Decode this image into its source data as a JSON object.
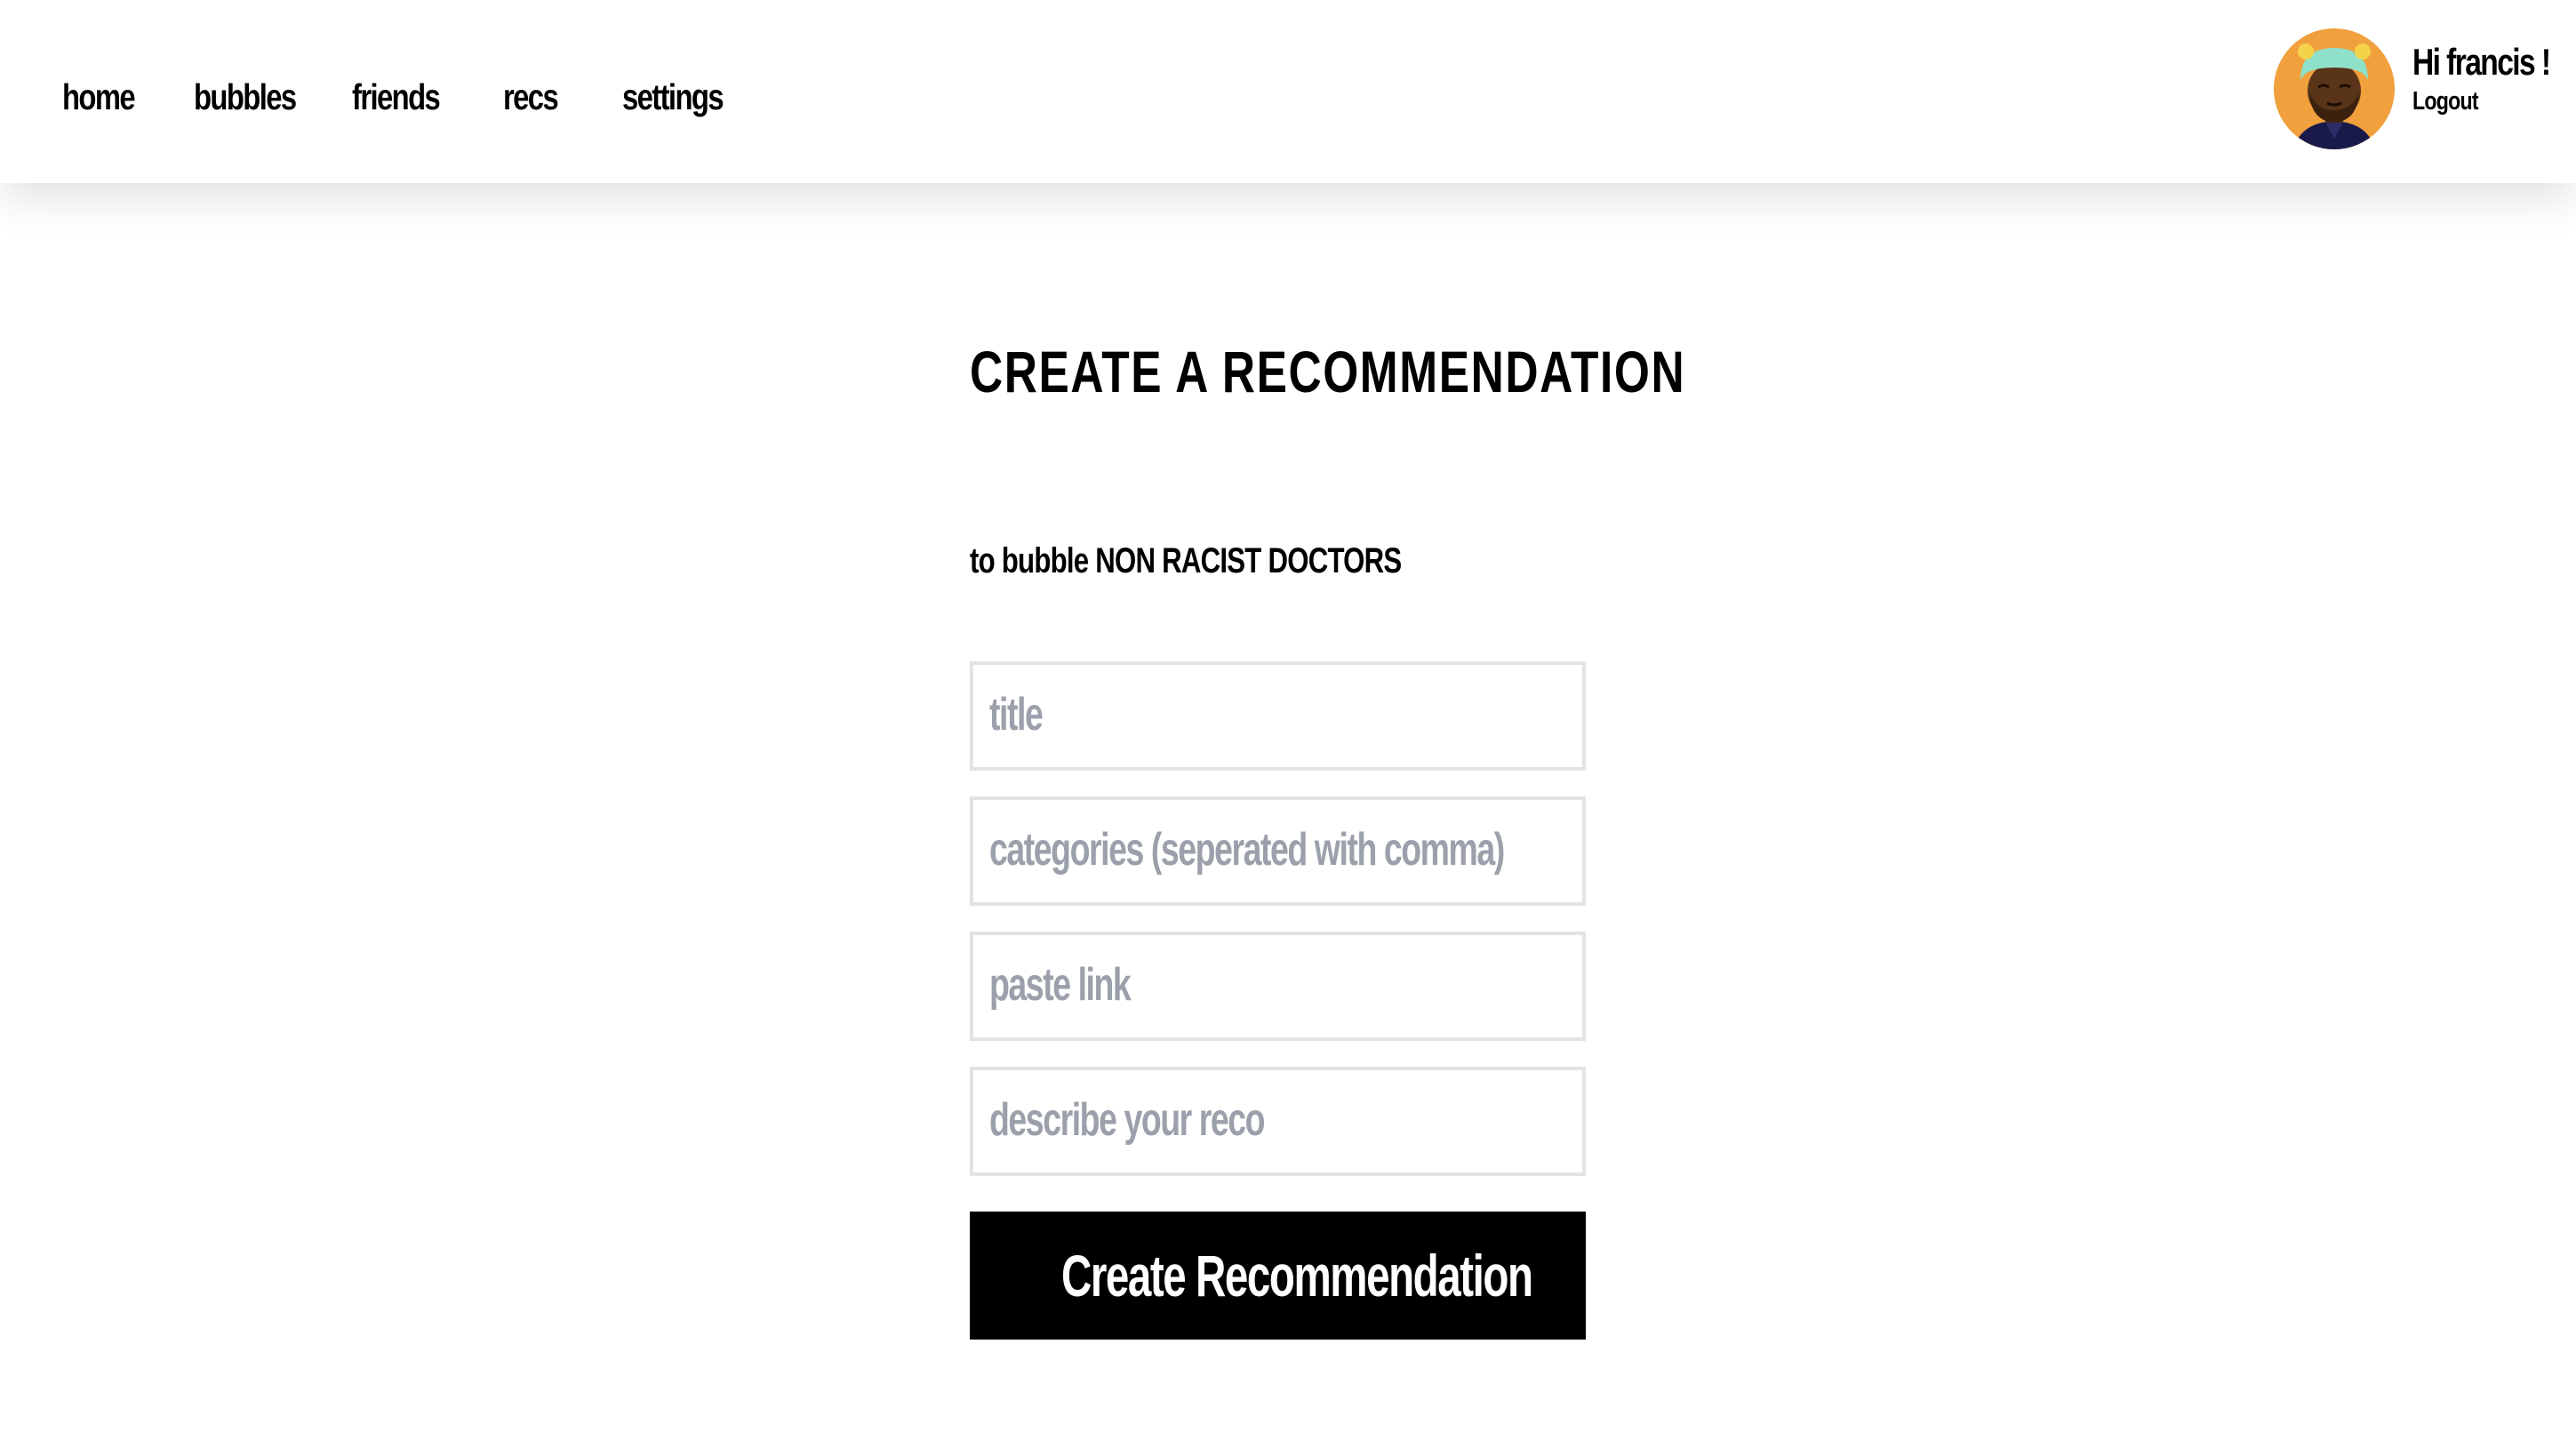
{
  "nav": {
    "items": [
      {
        "label": "home"
      },
      {
        "label": "bubbles"
      },
      {
        "label": "friends"
      },
      {
        "label": "recs"
      },
      {
        "label": "settings"
      }
    ]
  },
  "user": {
    "greeting": "Hi francis !",
    "logout_label": "Logout",
    "avatar_icon": "avatar-portrait-icon",
    "avatar_bg_color": "#f0a03c"
  },
  "main": {
    "title": "CREATE A RECOMMENDATION",
    "subtitle": "to bubble NON RACIST DOCTORS",
    "form": {
      "title_placeholder": "title",
      "title_value": "",
      "categories_placeholder": "categories (seperated with comma)",
      "categories_value": "",
      "link_placeholder": "paste link",
      "link_value": "",
      "description_placeholder": "describe your reco",
      "description_value": "",
      "submit_label": "Create Recommendation"
    }
  },
  "colors": {
    "button_bg": "#000000",
    "button_text": "#ffffff",
    "placeholder": "#9ba0ab",
    "field_border": "#e3e3e3"
  }
}
